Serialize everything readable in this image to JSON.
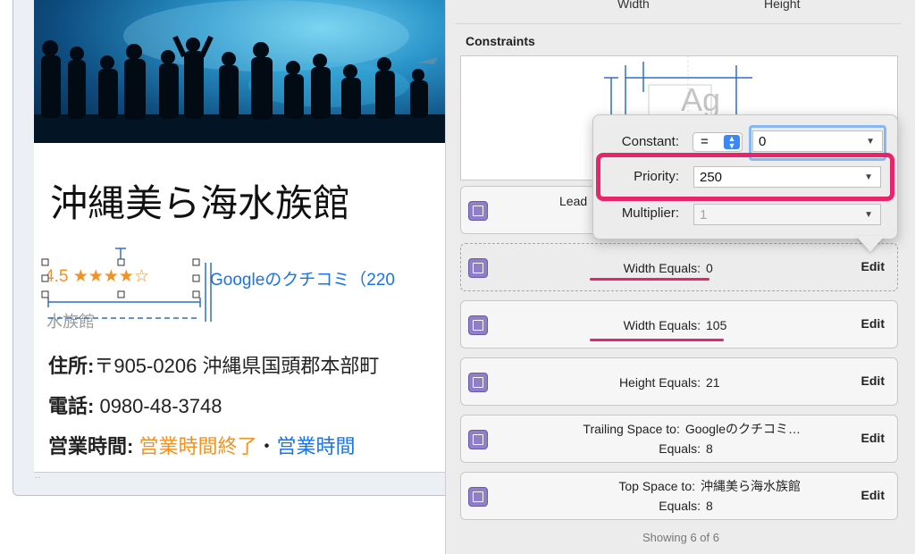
{
  "canvas": {
    "place_title": "沖縄美ら海水族館",
    "rating_score": "4.5",
    "rating_stars": "★★★★☆",
    "reviews_link": "Googleのクチコミ（220",
    "category": "水族館",
    "address_label": "住所:",
    "address_value": "〒905-0206 沖縄県国頭郡本部町",
    "phone_label": "電話:",
    "phone_value": "0980-48-3748",
    "hours_label": "営業時間:",
    "hours_status": "営業時間終了",
    "hours_separator": "・",
    "hours_link": "営業時間"
  },
  "inspector": {
    "column_headers": [
      "Width",
      "Height"
    ],
    "constraints_heading": "Constraints",
    "preview_glyph": "Ag",
    "rows": [
      {
        "key": "Lead",
        "value": "",
        "edit": ""
      },
      {
        "key": "Width Equals:",
        "value": "0",
        "edit": "Edit"
      },
      {
        "key": "Width Equals:",
        "value": "105",
        "edit": "Edit"
      },
      {
        "key": "Height Equals:",
        "value": "21",
        "edit": "Edit"
      },
      {
        "key": "Trailing Space to:",
        "value": "Googleのクチコミ…",
        "key2": "Equals:",
        "value2": "8",
        "edit": "Edit"
      },
      {
        "key": "Top Space to:",
        "value": "沖縄美ら海水族館",
        "key2": "Equals:",
        "value2": "8",
        "edit": "Edit"
      }
    ],
    "showing_count": "Showing 6 of 6"
  },
  "popover": {
    "constant_label": "Constant:",
    "relation_value": "=",
    "constant_value": "0",
    "priority_label": "Priority:",
    "priority_value": "250",
    "multiplier_label": "Multiplier:",
    "multiplier_value": "1"
  },
  "colors": {
    "highlight": "#e8246a",
    "star_orange": "#f5911e",
    "link_blue": "#1a73e8",
    "constraint_icon": "#8f7fc9",
    "focus_ring": "#86b7f2"
  }
}
